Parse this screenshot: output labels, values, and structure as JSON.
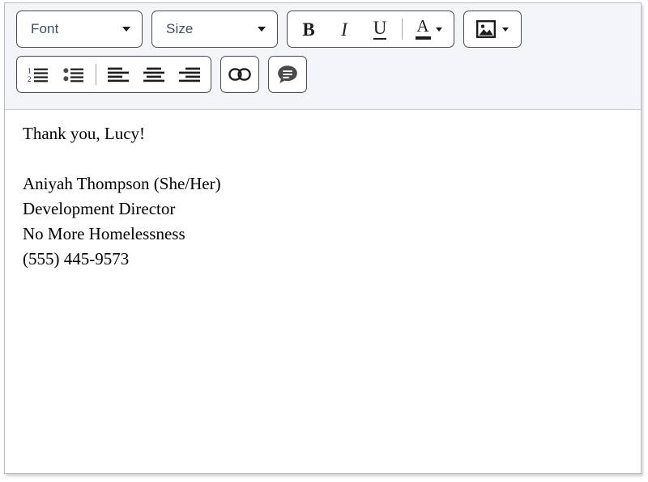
{
  "editor": {
    "toolbar": {
      "row1": {
        "font_dropdown": {
          "label": "Font",
          "icon": "chevron-down-icon"
        },
        "size_dropdown": {
          "label": "Size",
          "icon": "chevron-down-icon"
        },
        "bold": {
          "label": "B",
          "name": "bold-button"
        },
        "italic": {
          "label": "I",
          "name": "italic-button"
        },
        "underline": {
          "label": "U",
          "name": "underline-button"
        },
        "text_color": {
          "label": "A",
          "name": "text-color-button",
          "icon": "text-color-icon",
          "swatch": "#1c1c1c"
        },
        "insert_image": {
          "name": "insert-image-button",
          "icon": "image-icon"
        }
      },
      "row2": {
        "numbered_list": {
          "name": "numbered-list-button",
          "icon": "numbered-list-icon"
        },
        "bulleted_list": {
          "name": "bulleted-list-button",
          "icon": "bulleted-list-icon"
        },
        "align_left": {
          "name": "align-left-button",
          "icon": "align-left-icon"
        },
        "align_center": {
          "name": "align-center-button",
          "icon": "align-center-icon"
        },
        "align_right": {
          "name": "align-right-button",
          "icon": "align-right-icon"
        },
        "insert_link": {
          "name": "insert-link-button",
          "icon": "link-icon"
        },
        "comment": {
          "name": "comment-button",
          "icon": "comment-bubble-icon"
        }
      }
    },
    "body": {
      "lines": [
        "Thank you, Lucy!",
        "",
        "Aniyah Thompson (She/Her)",
        "Development Director",
        "No More Homelessness",
        "(555) 445-9573"
      ],
      "line_0": "Thank you, Lucy!",
      "line_1": "",
      "line_2": "Aniyah Thompson (She/Her)",
      "line_3": "Development Director",
      "line_4": "No More Homelessness",
      "line_5": "(555) 445-9573"
    }
  },
  "colors": {
    "toolbar_background": "#f4f5f9",
    "control_border": "#4a4a4a",
    "label_text": "#3d4d66",
    "body_text": "#000000",
    "window_border": "#b9bcc4"
  }
}
